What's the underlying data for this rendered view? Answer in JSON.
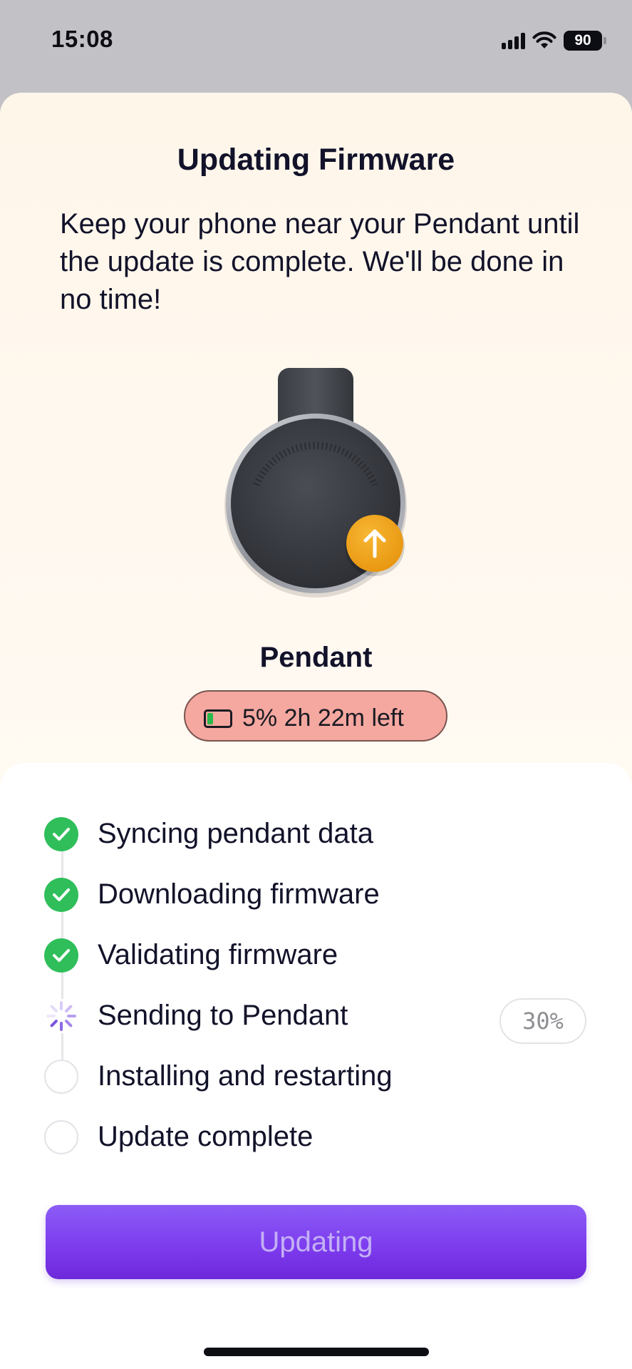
{
  "status_bar": {
    "time": "15:08",
    "battery_level": "90"
  },
  "sheet": {
    "title": "Updating Firmware",
    "description": "Keep your phone near your Pendant until the update is complete. We'll be done in no time!",
    "device_name": "Pendant",
    "battery_status": "5%  2h 22m left"
  },
  "steps": [
    {
      "label": "Syncing pendant data",
      "state": "done"
    },
    {
      "label": "Downloading firmware",
      "state": "done"
    },
    {
      "label": "Validating firmware",
      "state": "done"
    },
    {
      "label": "Sending to Pendant",
      "state": "active"
    },
    {
      "label": "Installing and restarting",
      "state": "pending"
    },
    {
      "label": "Update complete",
      "state": "pending"
    }
  ],
  "progress_text": "30%",
  "button_label": "Updating",
  "colors": {
    "accent": "#7c3aed",
    "done": "#2fbe5a",
    "upload_badge": "#f0a020",
    "battery_pill": "#f5a8a0"
  }
}
